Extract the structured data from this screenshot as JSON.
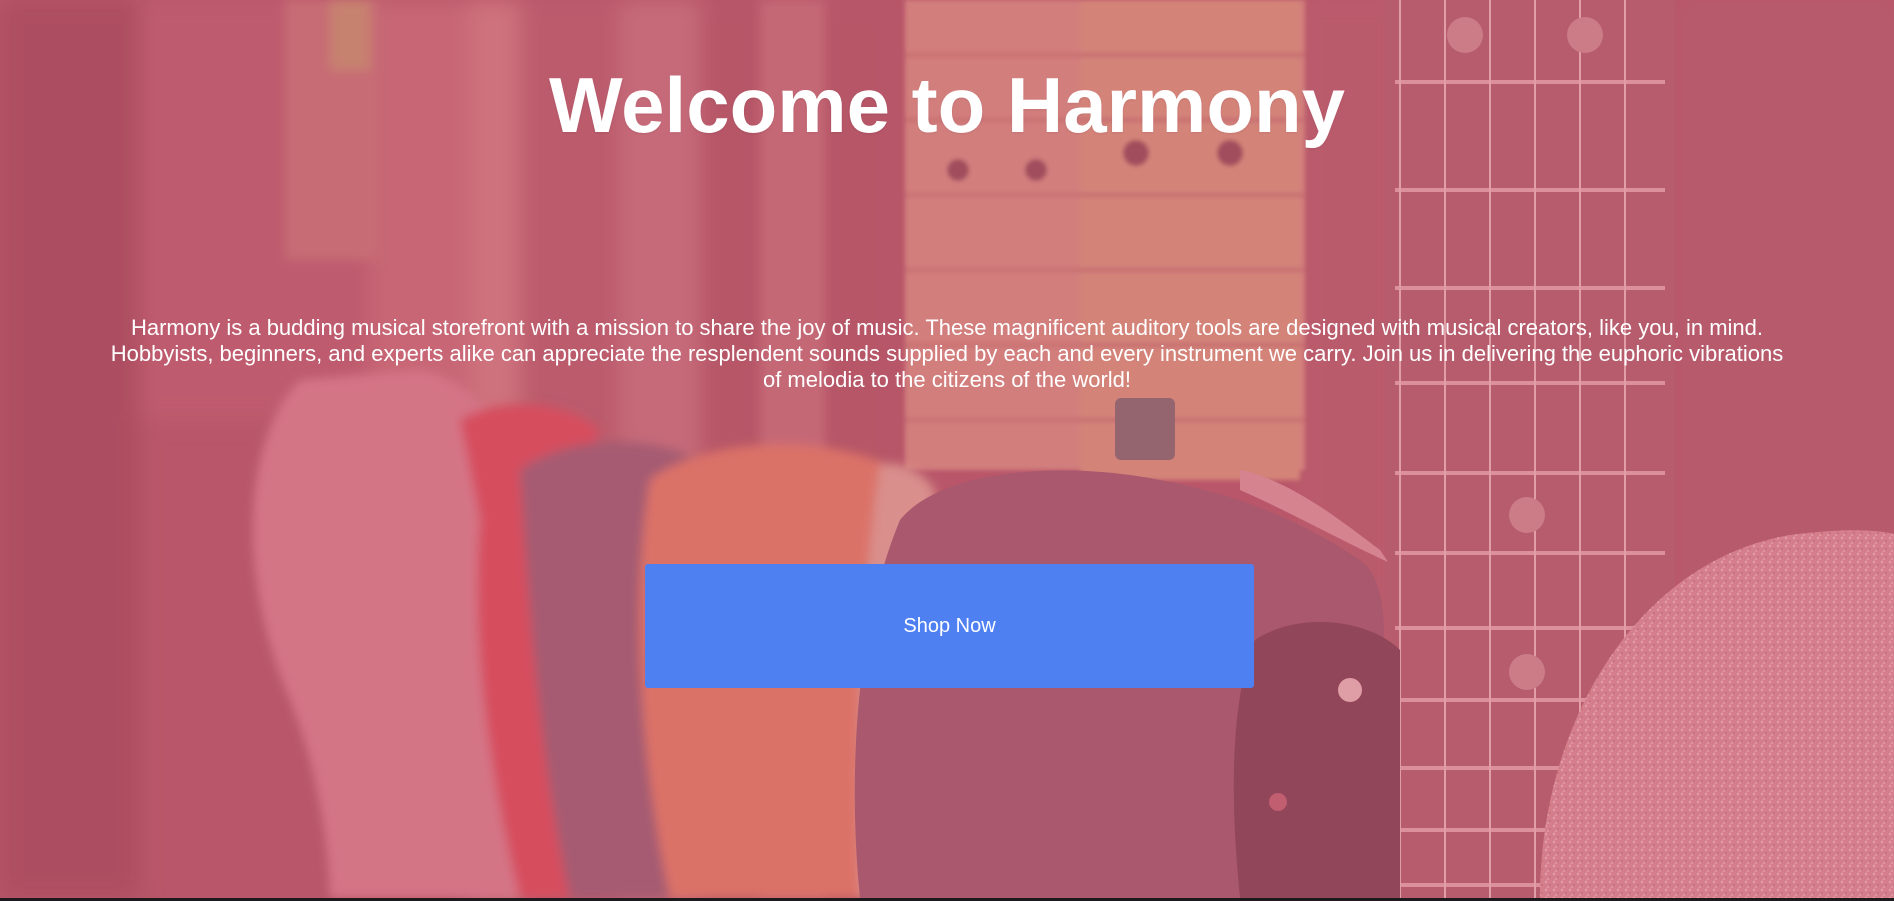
{
  "hero": {
    "title": "Welcome to Harmony",
    "description": "Harmony is a budding musical storefront with a mission to share the joy of music. These magnificent auditory tools are designed with musical creators, like you, in mind. Hobbyists, beginners, and experts alike can appreciate the resplendent sounds supplied by each and every instrument we carry. Join us in delivering the euphoric vibrations of melodia to the citizens of the world!",
    "cta_label": "Shop Now",
    "background_image": "guitar-row-image"
  },
  "colors": {
    "overlay_tint": "#b9586a",
    "button": "#4e80f2",
    "text": "#ffffff"
  }
}
